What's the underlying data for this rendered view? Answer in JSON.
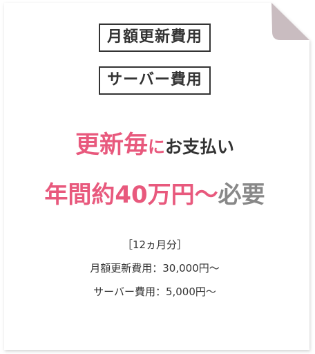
{
  "tags": {
    "renewal_fee": "月額更新費用",
    "server_fee": "サーバー費用"
  },
  "headline": {
    "line1_emphasis": "更新毎",
    "line1_particle": "に",
    "line1_rest": "お支払い",
    "line2_emphasis": "年間約40万円〜",
    "line2_rest": "必要"
  },
  "breakdown": {
    "heading": "［12ヵ月分］",
    "renewal_row": "月額更新費用：30,000円〜",
    "server_row": "サーバー費用：5,000円〜"
  },
  "colors": {
    "accent": "#e8597d",
    "text": "#333333",
    "muted": "#888888",
    "fold": "#c9bcc0"
  },
  "icons": {
    "page_corner": "folded-corner-icon"
  }
}
